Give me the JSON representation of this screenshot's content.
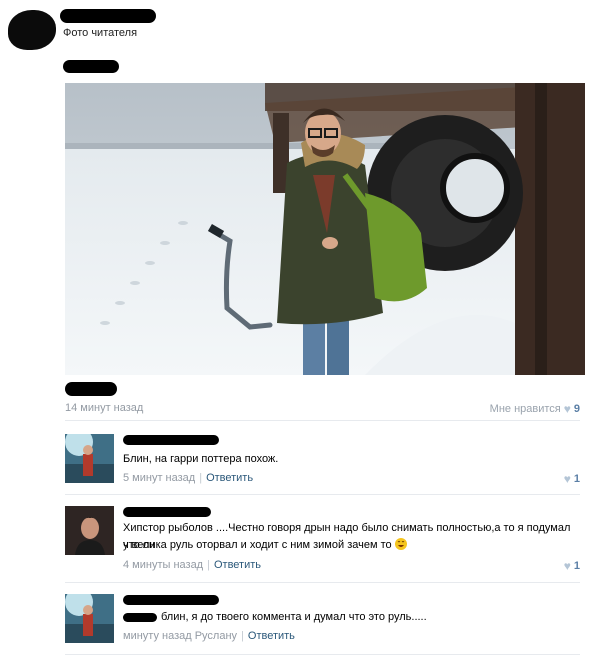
{
  "header": {
    "subtitle": "Фото читателя"
  },
  "post": {
    "time": "14 минут назад",
    "likes_label": "Мне нравится",
    "likes_count": "9"
  },
  "comments": [
    {
      "text": "Блин, на гарри поттера похож.",
      "time": "5 минут назад",
      "reply": "Ответить",
      "likes": "1"
    },
    {
      "text_line1": "Хипстор рыболов ....Честно говоря дрын надо было снимать полностью,а то я подумал что он",
      "text_line2": "у велика руль оторвал и ходит с ним зимой зачем то",
      "time": "4 минуты назад",
      "reply": "Ответить",
      "likes": "1"
    },
    {
      "text": "блин, я до твоего коммента и думал что это руль.....",
      "time": "минуту назад Руслану",
      "reply": "Ответить"
    }
  ],
  "icons": {
    "like": "heart-icon",
    "emoji": "laughing-emoji-icon"
  },
  "colors": {
    "meta_gray": "#939aa3",
    "link_blue": "#2b587a",
    "like_blue": "#5b7fa6",
    "divider": "#e7eaee"
  }
}
